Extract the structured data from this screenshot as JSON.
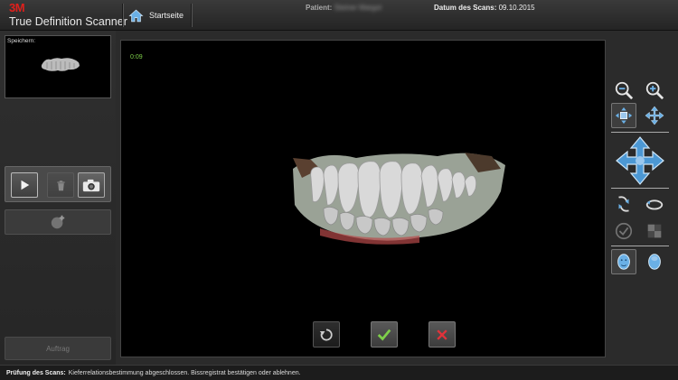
{
  "header": {
    "brand_logo": "3M",
    "brand_name": "True Definition Scanner",
    "home_label": "Startseite",
    "patient_label": "Patient:",
    "patient_name": "Steiner Margot",
    "scan_date_label": "Datum des Scans:",
    "scan_date_value": "09.10.2015"
  },
  "sidebar": {
    "memory_label": "Speichern:",
    "order_button_label": "Auftrag"
  },
  "viewport": {
    "timer": "0:09"
  },
  "status": {
    "title": "Prüfung des Scans:",
    "message": "Kieferrelationsbestimmung abgeschlossen. Bissregistrat bestätigen oder ablehnen."
  },
  "colors": {
    "brand_red": "#e0201c",
    "accent_blue": "#6ab0e6",
    "accept_green": "#7ecf4a",
    "reject_red": "#e0323a",
    "timer_green": "#7ecf4a"
  },
  "icons": {
    "home": "home-icon",
    "play": "play-icon",
    "trash": "trash-icon",
    "camera": "camera-icon",
    "add_scan": "add-scan-icon",
    "undo": "undo-icon",
    "accept": "check-icon",
    "reject": "x-icon",
    "zoom_out": "zoom-out-icon",
    "zoom_in": "zoom-in-icon"
  }
}
